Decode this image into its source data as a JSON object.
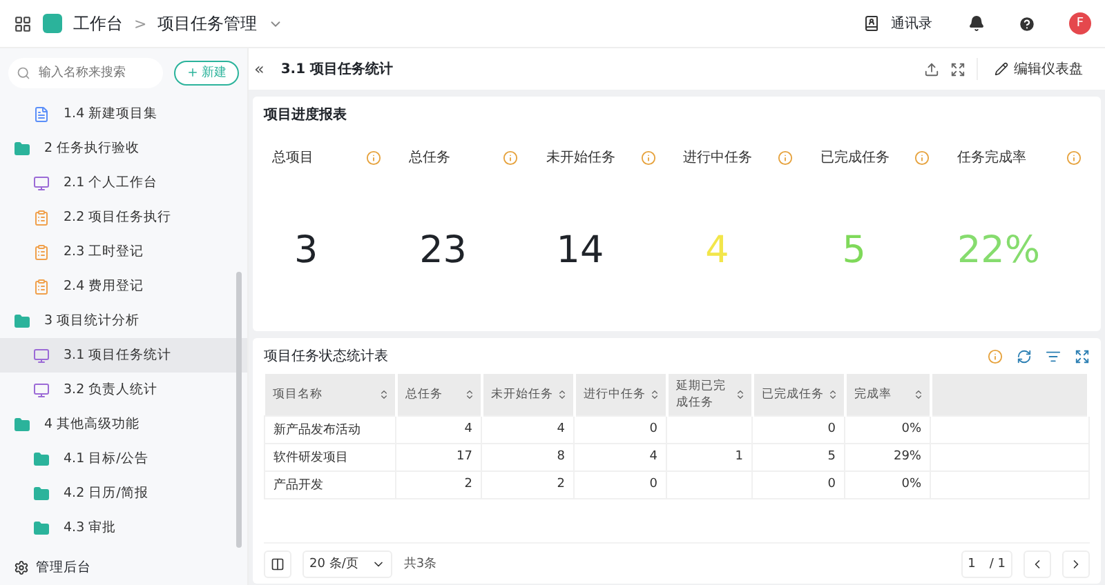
{
  "topbar": {
    "app_name": "工作台",
    "breadcrumb_separator": ">",
    "current": "项目任务管理",
    "actions": [
      {
        "label": "通讯录"
      }
    ],
    "avatar": "F"
  },
  "sidebar": {
    "search": {
      "placeholder": "输入名称来搜索"
    },
    "new_button": "新建",
    "continued_children": [
      {
        "label": "1.4 新建项目集",
        "kind": "doc",
        "selected": false
      }
    ],
    "groups": [
      {
        "label": "2 任务执行验收",
        "children": [
          {
            "label": "2.1 个人工作台",
            "kind": "monitor",
            "selected": false
          },
          {
            "label": "2.2 项目任务执行",
            "kind": "form",
            "selected": false
          },
          {
            "label": "2.3 工时登记",
            "kind": "form",
            "selected": false
          },
          {
            "label": "2.4 费用登记",
            "kind": "form",
            "selected": false
          }
        ]
      },
      {
        "label": "3 项目统计分析",
        "children": [
          {
            "label": "3.1 项目任务统计",
            "kind": "monitor",
            "selected": true
          },
          {
            "label": "3.2 负责人统计",
            "kind": "monitor",
            "selected": false
          }
        ]
      },
      {
        "label": "4 其他高级功能",
        "children": [
          {
            "label": "4.1 目标/公告",
            "kind": "folder",
            "selected": false
          },
          {
            "label": "4.2 日历/简报",
            "kind": "folder",
            "selected": false
          },
          {
            "label": "4.3 审批",
            "kind": "folder",
            "selected": false
          }
        ]
      }
    ],
    "footer": "管理后台"
  },
  "page": {
    "collapse": "«",
    "title": "3.1 项目任务统计",
    "edit_button": "编辑仪表盘"
  },
  "report": {
    "title": "项目进度报表",
    "stats": [
      {
        "label": "总项目",
        "value": "3",
        "color": "#1f2329"
      },
      {
        "label": "总任务",
        "value": "23",
        "color": "#1f2329"
      },
      {
        "label": "未开始任务",
        "value": "14",
        "color": "#1f2329"
      },
      {
        "label": "进行中任务",
        "value": "4",
        "color": "#f2e64a"
      },
      {
        "label": "已完成任务",
        "value": "5",
        "color": "#7fd95a"
      },
      {
        "label": "任务完成率",
        "value": "22%",
        "color": "#86dc6e"
      }
    ]
  },
  "table": {
    "title": "项目任务状态统计表",
    "columns": [
      "项目名称",
      "总任务",
      "未开始任务",
      "进行中任务",
      "延期已完成任务",
      "已完成任务",
      "完成率"
    ],
    "rows": [
      [
        "新产品发布活动",
        "4",
        "4",
        "0",
        "",
        "0",
        "0%"
      ],
      [
        "软件研发项目",
        "17",
        "8",
        "4",
        "1",
        "5",
        "29%"
      ],
      [
        "产品开发",
        "2",
        "2",
        "0",
        "",
        "0",
        "0%"
      ]
    ],
    "page_size": "20 条/页",
    "total": "共3条",
    "current_page": "1",
    "page_count": "/ 1"
  }
}
